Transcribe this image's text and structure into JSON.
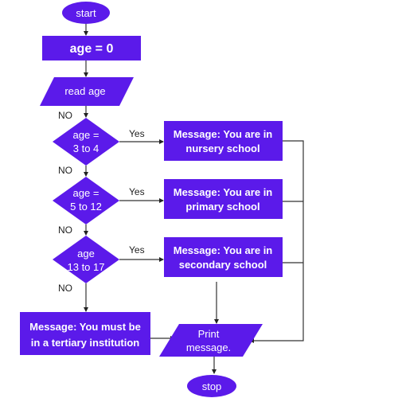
{
  "diagram": {
    "type": "flowchart",
    "colors": {
      "node_fill": "#5b1aea",
      "node_text": "#ffffff",
      "edge": "#333333",
      "label": "#222222"
    },
    "nodes": {
      "start": {
        "shape": "ellipse",
        "lines": [
          "start"
        ]
      },
      "init": {
        "shape": "rect",
        "lines": [
          "age = 0"
        ]
      },
      "read": {
        "shape": "parallelogram",
        "lines": [
          "read age"
        ]
      },
      "d1": {
        "shape": "diamond",
        "lines": [
          "age =",
          "3 to 4"
        ]
      },
      "d2": {
        "shape": "diamond",
        "lines": [
          "age =",
          "5 to 12"
        ]
      },
      "d3": {
        "shape": "diamond",
        "lines": [
          "age",
          "13 to 17"
        ]
      },
      "m1": {
        "shape": "rect",
        "lines": [
          "Message: You are in",
          "nursery school"
        ]
      },
      "m2": {
        "shape": "rect",
        "lines": [
          "Message: You are in",
          "primary school"
        ]
      },
      "m3": {
        "shape": "rect",
        "lines": [
          "Message: You are in",
          "secondary school"
        ]
      },
      "m4": {
        "shape": "rect",
        "lines": [
          "Message: You must be",
          "in a tertiary institution"
        ]
      },
      "print": {
        "shape": "parallelogram",
        "lines": [
          "Print",
          "message."
        ]
      },
      "stop": {
        "shape": "ellipse",
        "lines": [
          "stop"
        ]
      }
    },
    "edge_labels": {
      "no1": "NO",
      "no2": "NO",
      "no3": "NO",
      "no4": "NO",
      "yes1": "Yes",
      "yes2": "Yes",
      "yes3": "Yes"
    },
    "edges": [
      [
        "start",
        "init"
      ],
      [
        "init",
        "read"
      ],
      [
        "read",
        "d1",
        "NO"
      ],
      [
        "d1",
        "m1",
        "Yes"
      ],
      [
        "d1",
        "d2",
        "NO"
      ],
      [
        "d2",
        "m2",
        "Yes"
      ],
      [
        "d2",
        "d3",
        "NO"
      ],
      [
        "d3",
        "m3",
        "Yes"
      ],
      [
        "d3",
        "m4",
        "NO"
      ],
      [
        "m1",
        "print"
      ],
      [
        "m2",
        "print"
      ],
      [
        "m3",
        "print"
      ],
      [
        "m4",
        "print"
      ],
      [
        "print",
        "stop"
      ]
    ]
  }
}
